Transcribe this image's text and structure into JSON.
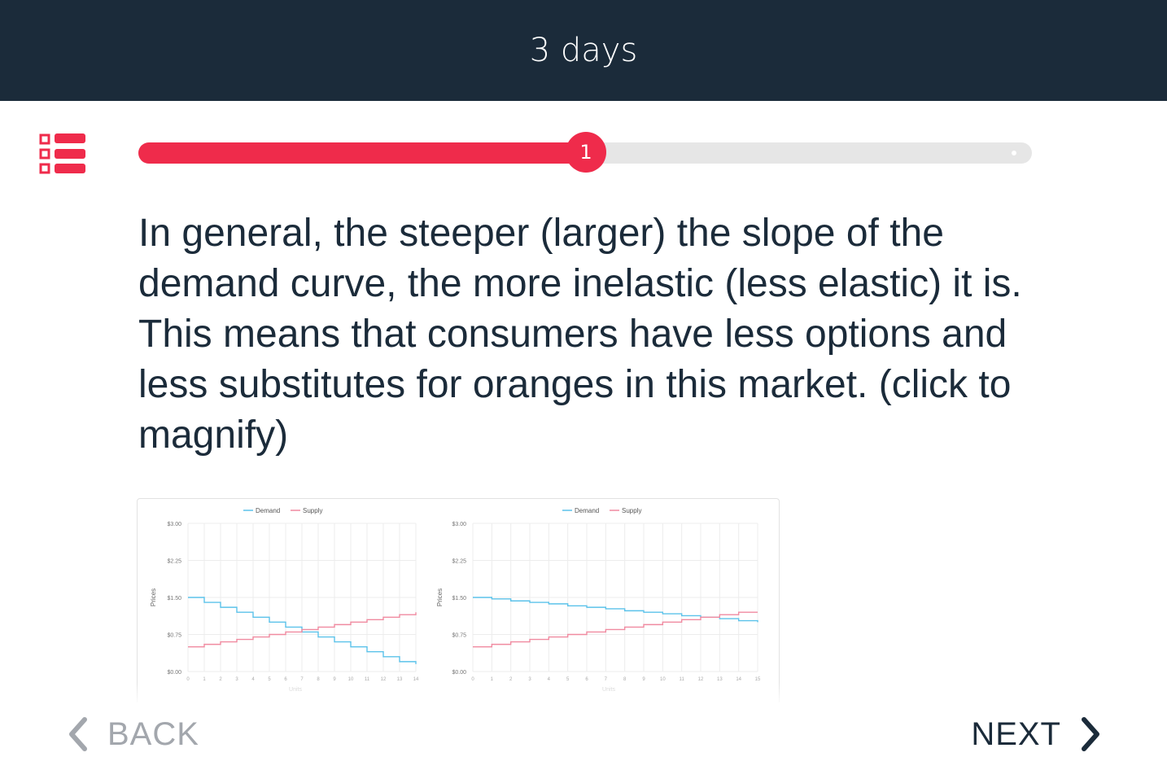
{
  "header": {
    "title": "3 days"
  },
  "progress": {
    "current_step": "1",
    "fraction": 0.48
  },
  "lesson": {
    "text": "In general, the steeper (larger) the slope of the demand curve, the more inelastic (less elastic) it is. This means that consumers have less options and less substitutes for oranges in this market. (click to magnify)"
  },
  "nav": {
    "back_label": "BACK",
    "next_label": "NEXT"
  },
  "colors": {
    "header_bg": "#1b2b3a",
    "accent": "#ef2b4b",
    "demand": "#5bc2ea",
    "supply": "#f08aa0",
    "disabled": "#a3a7ad"
  },
  "icons": {
    "menu": "list-menu-icon",
    "back": "chevron-left-icon",
    "next": "chevron-right-icon"
  },
  "chart_data": [
    {
      "type": "line",
      "step": true,
      "legend": [
        "Demand",
        "Supply"
      ],
      "legend_position": "top-center",
      "ylabel": "Prices",
      "xlabel": "Units",
      "ylim": [
        0,
        3
      ],
      "yticks": [
        "$0.00",
        "$0.75",
        "$1.50",
        "$2.25",
        "$3.00"
      ],
      "xticks": [
        "0",
        "1",
        "2",
        "3",
        "4",
        "5",
        "6",
        "7",
        "8",
        "9",
        "10",
        "11",
        "12",
        "13",
        "14"
      ],
      "x": [
        0,
        1,
        2,
        3,
        4,
        5,
        6,
        7,
        8,
        9,
        10,
        11,
        12,
        13,
        14
      ],
      "series": [
        {
          "name": "Demand",
          "values": [
            1.5,
            1.4,
            1.3,
            1.2,
            1.1,
            1.0,
            0.9,
            0.8,
            0.7,
            0.6,
            0.5,
            0.4,
            0.3,
            0.2,
            0.15
          ]
        },
        {
          "name": "Supply",
          "values": [
            0.5,
            0.55,
            0.6,
            0.65,
            0.7,
            0.75,
            0.8,
            0.85,
            0.9,
            0.95,
            1.0,
            1.05,
            1.1,
            1.15,
            1.2
          ]
        }
      ],
      "grid": true
    },
    {
      "type": "line",
      "step": true,
      "legend": [
        "Demand",
        "Supply"
      ],
      "legend_position": "top-center",
      "ylabel": "Prices",
      "xlabel": "Units",
      "ylim": [
        0,
        3
      ],
      "yticks": [
        "$0.00",
        "$0.75",
        "$1.50",
        "$2.25",
        "$3.00"
      ],
      "xticks": [
        "0",
        "1",
        "2",
        "3",
        "4",
        "5",
        "6",
        "7",
        "8",
        "9",
        "10",
        "11",
        "12",
        "13",
        "14",
        "15"
      ],
      "x": [
        0,
        1,
        2,
        3,
        4,
        5,
        6,
        7,
        8,
        9,
        10,
        11,
        12,
        13,
        14,
        15
      ],
      "series": [
        {
          "name": "Demand",
          "values": [
            1.5,
            1.47,
            1.43,
            1.4,
            1.37,
            1.33,
            1.3,
            1.27,
            1.23,
            1.2,
            1.17,
            1.13,
            1.1,
            1.07,
            1.03,
            1.0
          ]
        },
        {
          "name": "Supply",
          "values": [
            0.5,
            0.55,
            0.6,
            0.65,
            0.7,
            0.75,
            0.8,
            0.85,
            0.9,
            0.95,
            1.0,
            1.05,
            1.1,
            1.15,
            1.2,
            1.2
          ]
        }
      ],
      "grid": true
    }
  ]
}
